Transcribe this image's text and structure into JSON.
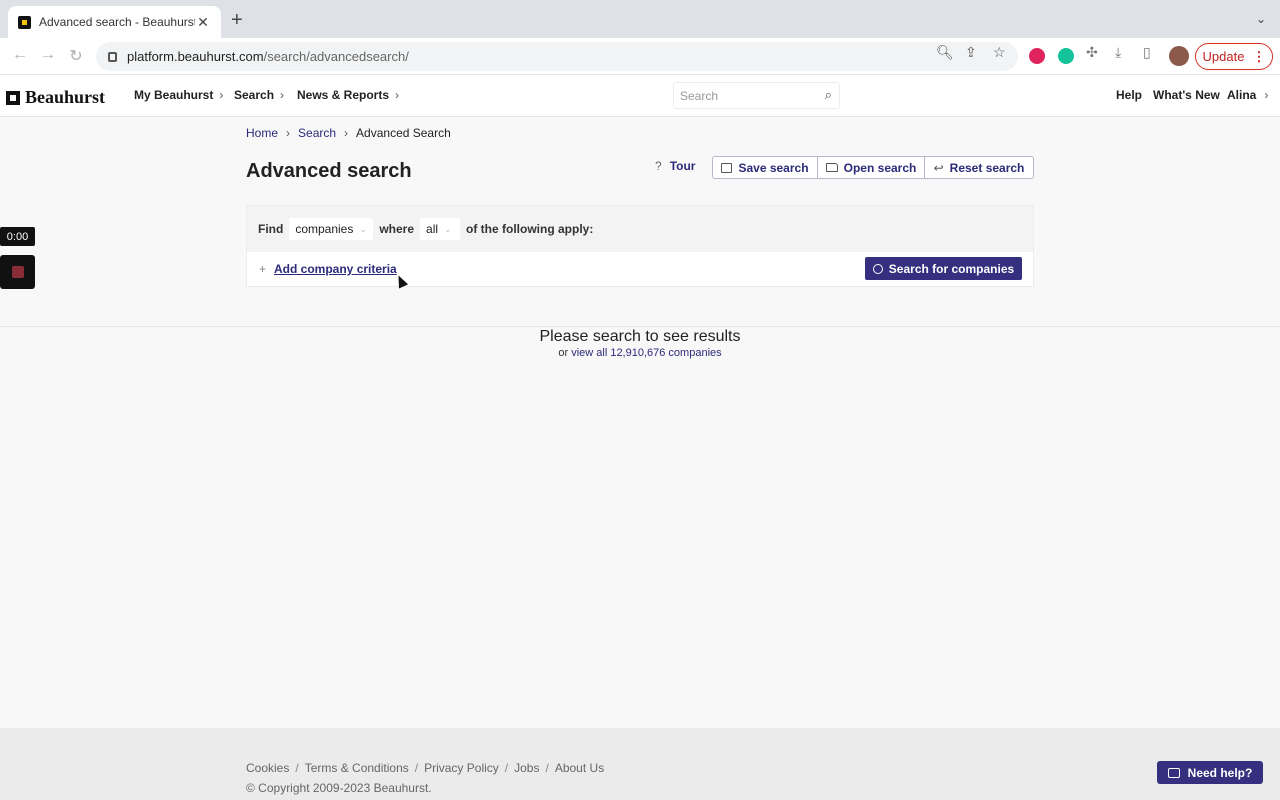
{
  "browser": {
    "tab_title": "Advanced search - Beauhurst",
    "url_domain": "platform.beauhurst.com",
    "url_path": "/search/advancedsearch/",
    "update_label": "Update"
  },
  "header": {
    "logo_text": "Beauhurst",
    "nav": [
      "My Beauhurst",
      "Search",
      "News & Reports"
    ],
    "search_placeholder": "Search",
    "right_links": [
      "Help",
      "What's New",
      "Alina"
    ]
  },
  "recorder": {
    "time": "0:00"
  },
  "breadcrumb": [
    "Home",
    "Search",
    "Advanced Search"
  ],
  "page_title": "Advanced search",
  "actions": {
    "tour": "Tour",
    "save": "Save search",
    "open": "Open search",
    "reset": "Reset search"
  },
  "criteria": {
    "find_label": "Find",
    "entity_value": "companies",
    "where_label": "where",
    "match_value": "all",
    "tail_label": "of the following apply:",
    "add_label": "Add company criteria",
    "search_button": "Search for companies"
  },
  "results": {
    "empty_title": "Please search to see results",
    "or_text": "or",
    "view_all_link": "view all 12,910,676 companies"
  },
  "footer": {
    "links": [
      "Cookies",
      "Terms & Conditions",
      "Privacy Policy",
      "Jobs",
      "About Us"
    ],
    "copyright": "© Copyright 2009-2023 Beauhurst.",
    "help_button": "Need help?"
  },
  "colors": {
    "accent": "#34307f",
    "link": "#2d2a7a",
    "chrome_update": "#c5221f"
  }
}
